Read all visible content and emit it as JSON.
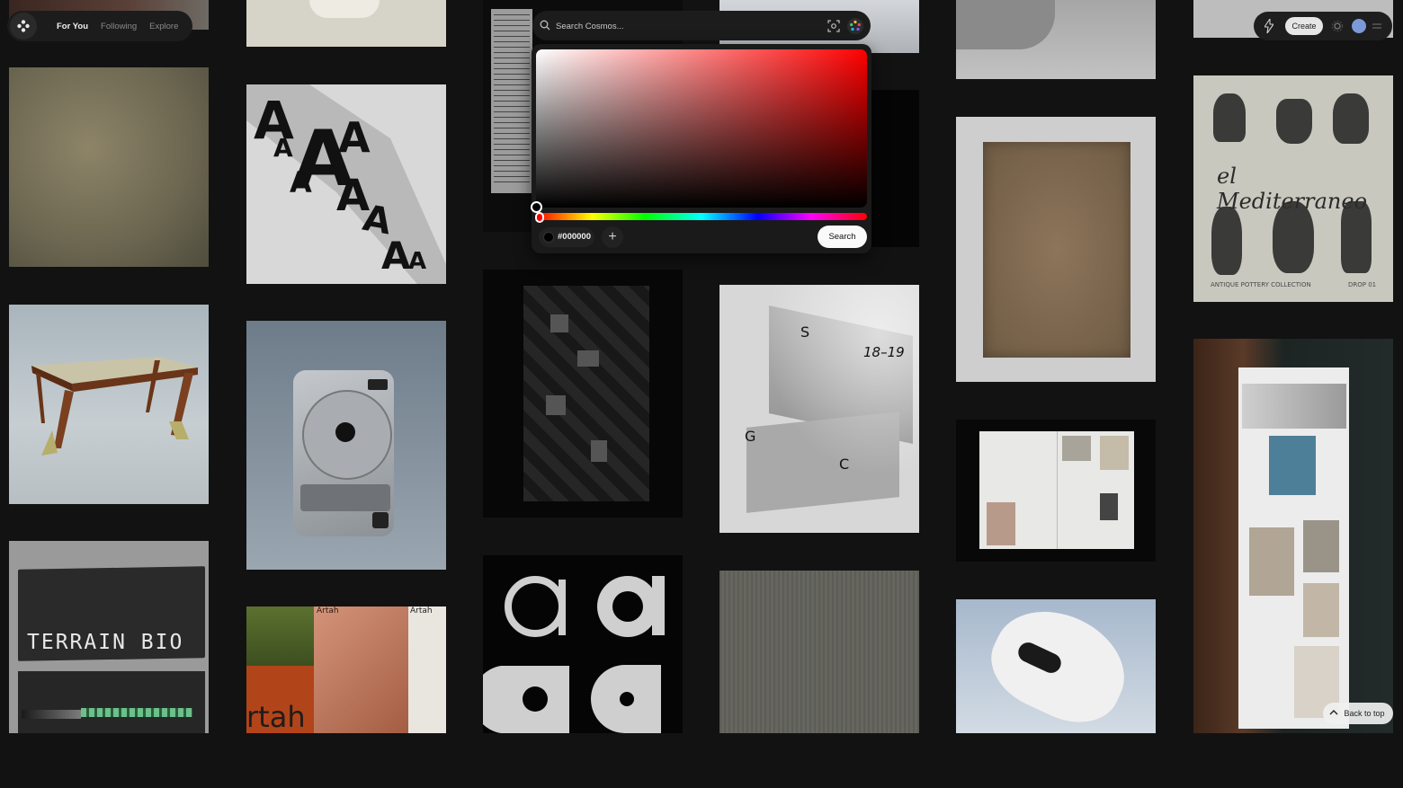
{
  "nav": {
    "for_you": "For You",
    "following": "Following",
    "explore": "Explore"
  },
  "search": {
    "placeholder": "Search Cosmos...",
    "button": "Search"
  },
  "color_picker": {
    "selected_hex": "#000000",
    "selected_color": "#000000",
    "hue_color": "#ff0000"
  },
  "topbar": {
    "create": "Create"
  },
  "back_to_top": "Back to top",
  "tiles": {
    "terrain_text": "TERRAIN BIO",
    "artah_text": "rtah",
    "artah_header_1": "Artah",
    "artah_header_2": "Artah",
    "poster_s": "S",
    "poster_year": "18–19",
    "poster_g": "G",
    "poster_c": "C",
    "mediterraneo_title": "el Mediterraneo",
    "mediterraneo_caption_left": "ANTIQUE POTTERY COLLECTION",
    "mediterraneo_caption_right": "DROP 01"
  }
}
